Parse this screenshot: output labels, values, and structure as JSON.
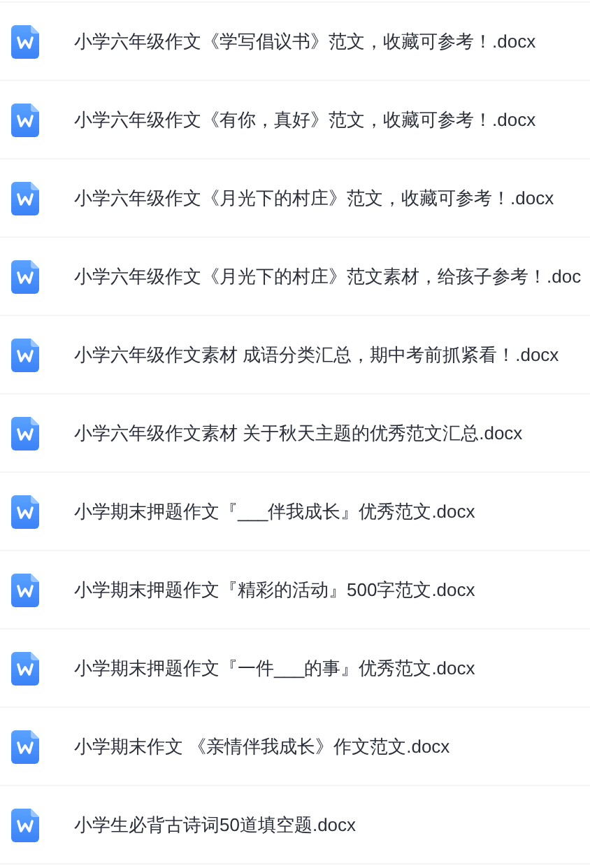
{
  "files": [
    {
      "name": "小学六年级作文《学写倡议书》范文，收藏可参考！.docx"
    },
    {
      "name": "小学六年级作文《有你，真好》范文，收藏可参考！.docx"
    },
    {
      "name": "小学六年级作文《月光下的村庄》范文，收藏可参考！.docx"
    },
    {
      "name": "小学六年级作文《月光下的村庄》范文素材，给孩子参考！.doc"
    },
    {
      "name": "小学六年级作文素材 成语分类汇总，期中考前抓紧看！.docx"
    },
    {
      "name": "小学六年级作文素材 关于秋天主题的优秀范文汇总.docx"
    },
    {
      "name": "小学期末押题作文『___伴我成长』优秀范文.docx"
    },
    {
      "name": "小学期末押题作文『精彩的活动』500字范文.docx"
    },
    {
      "name": "小学期末押题作文『一件___的事』优秀范文.docx"
    },
    {
      "name": "小学期末作文 《亲情伴我成长》作文范文.docx"
    },
    {
      "name": "小学生必背古诗词50道填空题.docx"
    }
  ]
}
